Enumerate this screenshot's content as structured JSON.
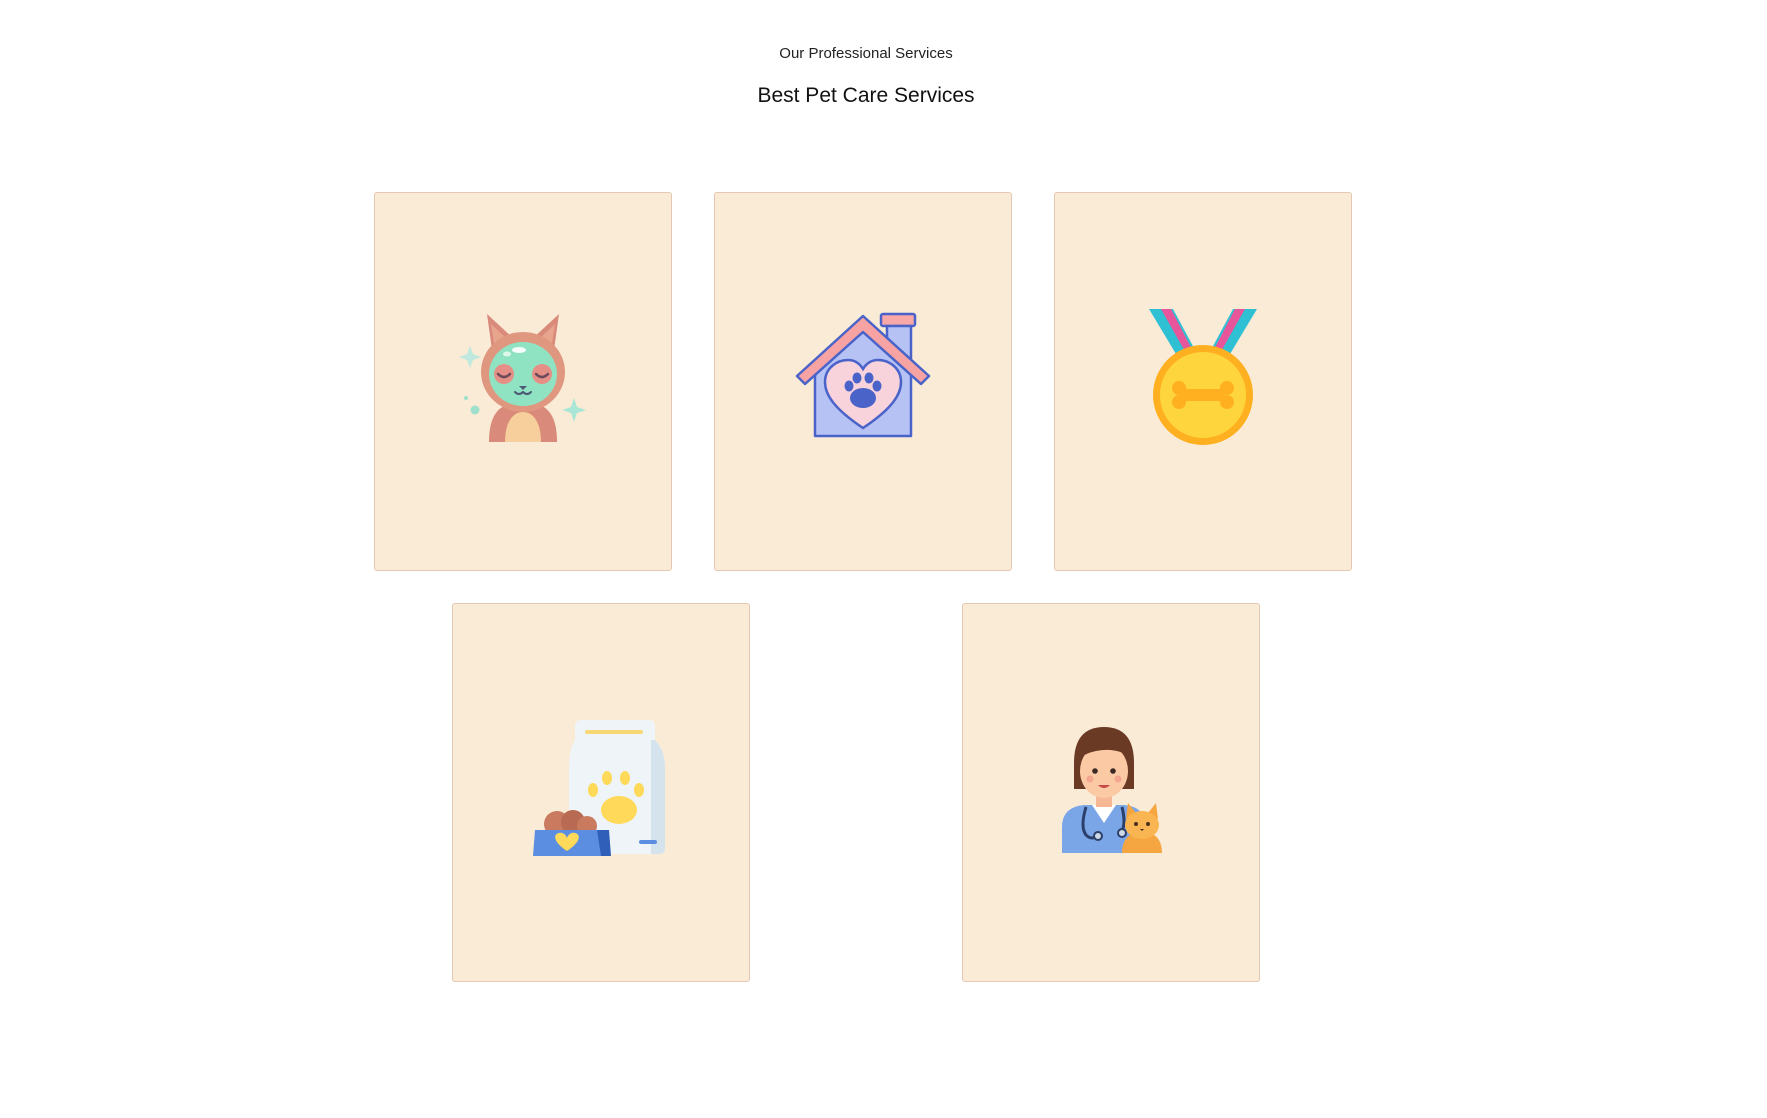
{
  "section": {
    "eyebrow": "Our Professional Services",
    "title": "Best Pet Care Services"
  },
  "cards": [
    {
      "icon": "pet-grooming-icon"
    },
    {
      "icon": "pet-house-icon"
    },
    {
      "icon": "medal-icon"
    },
    {
      "icon": "pet-food-icon"
    },
    {
      "icon": "veterinarian-icon"
    }
  ],
  "colors": {
    "card_background": "#faebd7",
    "card_border": "#e3c9b3"
  }
}
